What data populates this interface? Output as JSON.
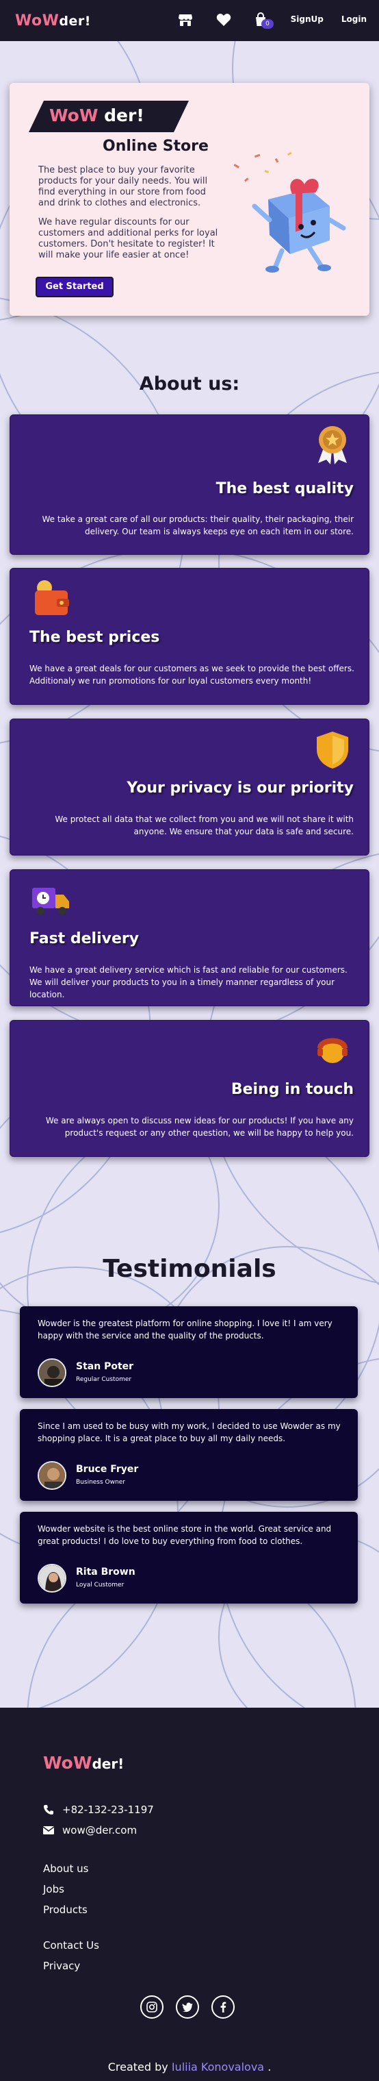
{
  "header": {
    "logo_wow": "WoW",
    "logo_der": "der!",
    "cart_count": "0",
    "signup": "SignUp",
    "login": "Login"
  },
  "hero": {
    "badge_wow": "WoW",
    "badge_der": "der!",
    "title": "Online Store",
    "paragraph1": "The best place to buy your favorite products for your daily needs. You will find everything in our store from food and drink to clothes and electronics.",
    "paragraph2": "We have regular discounts for our customers and additional perks for loyal customers. Don't hesitate to register! It will make your life easier at once!",
    "cta": "Get Started"
  },
  "about": {
    "title": "About us:",
    "cards": [
      {
        "title": "The best quality",
        "text": "We take a great care of all our products: their quality, their packaging, their delivery. Our team is always keeps eye on each item in our store.",
        "icon": "medal-icon"
      },
      {
        "title": "The best prices",
        "text": "We have a great deals for our customers as we seek to provide the best offers. Additionaly we run promotions for our loyal customers every month!",
        "icon": "wallet-icon"
      },
      {
        "title": "Your privacy is our priority",
        "text": "We protect all data that we collect from you and we will not share it with anyone. We ensure that your data is safe and secure.",
        "icon": "shield-icon"
      },
      {
        "title": "Fast delivery",
        "text": "We have a great delivery service which is fast and reliable for our customers. We will deliver your products to you in a timely manner regardless of your location.",
        "icon": "truck-icon"
      },
      {
        "title": "Being in touch",
        "text": "We are always open to discuss new ideas for our products! If you have any product's request or any other question, we will be happy to help you.",
        "icon": "support-agent-icon"
      }
    ]
  },
  "testimonials": {
    "title": "Testimonials",
    "items": [
      {
        "text": "Wowder is the greatest platform for online shopping. I love it! I am very happy with the service and the quality of the products.",
        "name": "Stan Poter",
        "role": "Regular Customer"
      },
      {
        "text": "Since I am used to be busy with my work, I decided to use Wowder as my shopping place. It is a great place to buy all my daily needs.",
        "name": "Bruce Fryer",
        "role": "Business Owner"
      },
      {
        "text": "Wowder website is the best online store in the world. Great service and great products! I do love to buy everything from food to clothes.",
        "name": "Rita Brown",
        "role": "Loyal Customer"
      }
    ]
  },
  "footer": {
    "logo_wow": "WoW",
    "logo_der": "der!",
    "phone": "+82-132-23-1197",
    "email": "wow@der.com",
    "links1": [
      "About us",
      "Jobs",
      "Products"
    ],
    "links2": [
      "Contact Us",
      "Privacy"
    ],
    "credit_prefix": "Created by ",
    "credit_author": "Iuliia Konovalova",
    "credit_suffix": " ."
  },
  "colors": {
    "accent_pink": "#f07090",
    "card_purple": "#3a1e78",
    "dark_bg": "#1b1829",
    "button": "#3a13a8"
  }
}
